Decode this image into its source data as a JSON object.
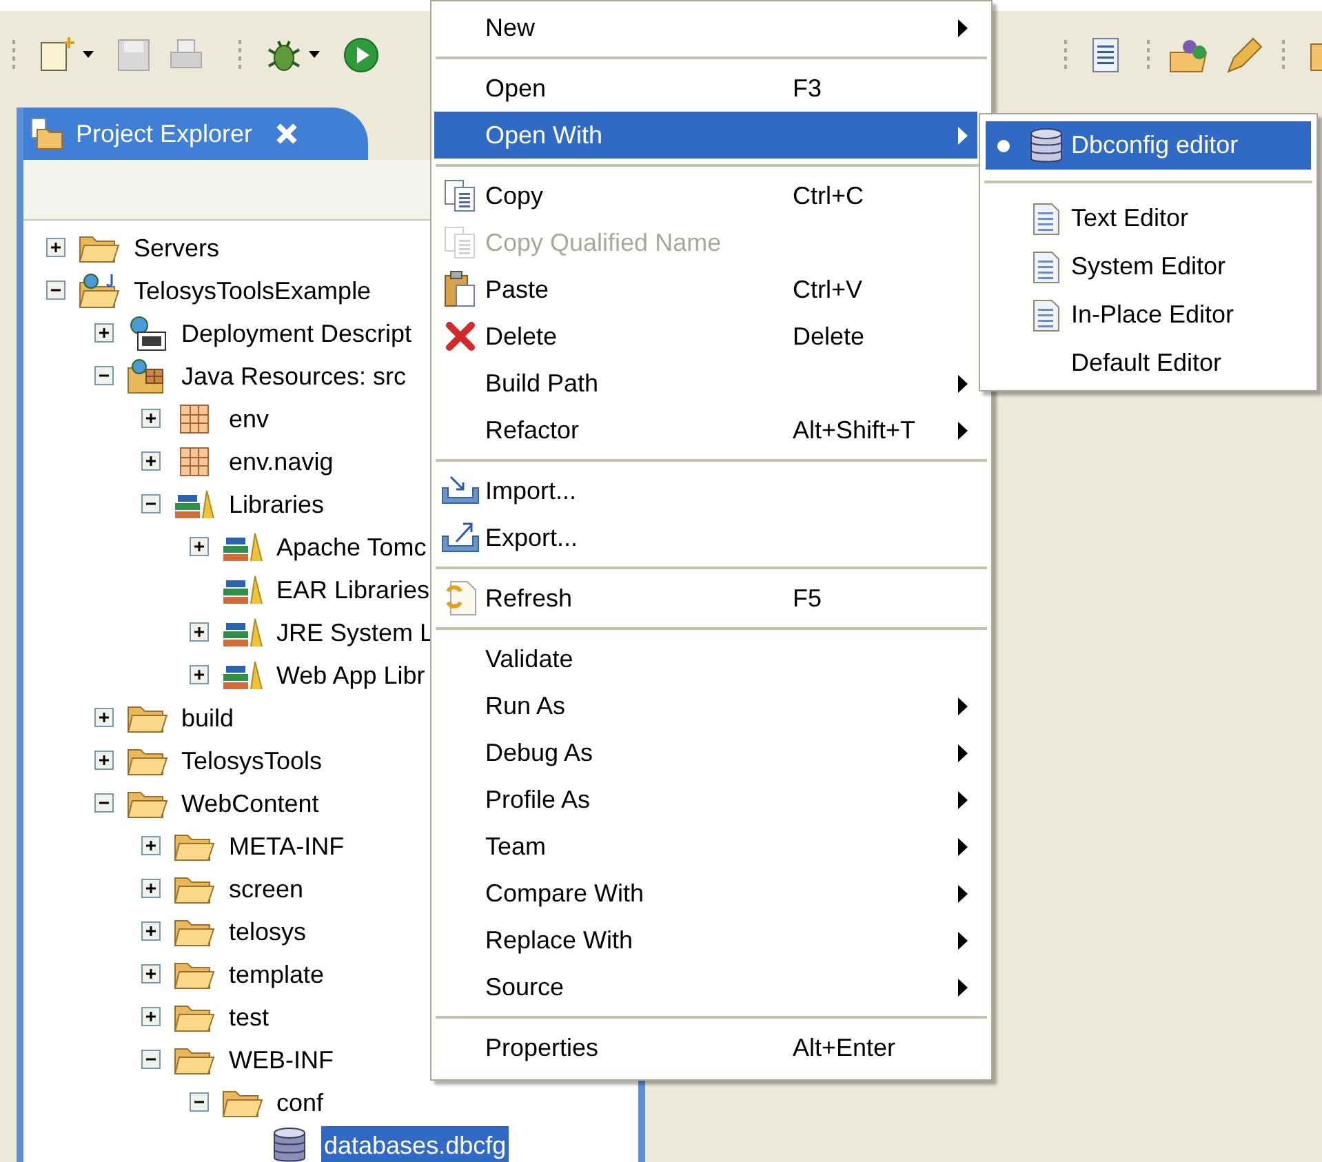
{
  "panel": {
    "title": "Project Explorer"
  },
  "tree": [
    {
      "label": "Servers",
      "kind": "folder",
      "expanded": false,
      "selected": false
    },
    {
      "label": "TelosysToolsExample",
      "kind": "project",
      "expanded": true,
      "selected": false,
      "children": [
        {
          "label": "Deployment Descript",
          "kind": "descriptor",
          "expanded": false,
          "selected": false
        },
        {
          "label": "Java Resources: src",
          "kind": "source",
          "expanded": true,
          "selected": false,
          "children": [
            {
              "label": "env",
              "kind": "package",
              "expanded": false,
              "selected": false
            },
            {
              "label": "env.navig",
              "kind": "package",
              "expanded": false,
              "selected": false
            },
            {
              "label": "Libraries",
              "kind": "library",
              "expanded": true,
              "selected": false,
              "children": [
                {
                  "label": "Apache Tomc",
                  "kind": "library",
                  "expanded": false,
                  "selected": false
                },
                {
                  "label": "EAR Libraries",
                  "kind": "library",
                  "selected": false
                },
                {
                  "label": "JRE System L",
                  "kind": "library",
                  "expanded": false,
                  "selected": false
                },
                {
                  "label": "Web App Libr",
                  "kind": "library",
                  "expanded": false,
                  "selected": false
                }
              ]
            }
          ]
        },
        {
          "label": "build",
          "kind": "folder",
          "expanded": false,
          "selected": false
        },
        {
          "label": "TelosysTools",
          "kind": "folder",
          "expanded": false,
          "selected": false
        },
        {
          "label": "WebContent",
          "kind": "folder",
          "expanded": true,
          "selected": false,
          "children": [
            {
              "label": "META-INF",
              "kind": "folder",
              "expanded": false,
              "selected": false
            },
            {
              "label": "screen",
              "kind": "folder",
              "expanded": false,
              "selected": false
            },
            {
              "label": "telosys",
              "kind": "folder",
              "expanded": false,
              "selected": false
            },
            {
              "label": "template",
              "kind": "folder",
              "expanded": false,
              "selected": false
            },
            {
              "label": "test",
              "kind": "folder",
              "expanded": false,
              "selected": false
            },
            {
              "label": "WEB-INF",
              "kind": "folder",
              "expanded": true,
              "selected": false,
              "children": [
                {
                  "label": "conf",
                  "kind": "folder",
                  "expanded": true,
                  "selected": false,
                  "children": [
                    {
                      "label": "databases.dbcfg",
                      "kind": "database",
                      "selected": true
                    }
                  ]
                }
              ]
            }
          ]
        }
      ]
    }
  ],
  "context_menu": [
    {
      "kind": "item",
      "label": "New",
      "submenu": true,
      "selected": false,
      "disabled": false
    },
    {
      "kind": "separator"
    },
    {
      "kind": "item",
      "label": "Open",
      "shortcut": "F3",
      "submenu": false,
      "selected": false,
      "disabled": false
    },
    {
      "kind": "item",
      "label": "Open With",
      "submenu": true,
      "selected": true,
      "disabled": false
    },
    {
      "kind": "separator"
    },
    {
      "kind": "copy",
      "label": "Copy",
      "shortcut": "Ctrl+C",
      "submenu": false,
      "selected": false,
      "disabled": false
    },
    {
      "kind": "copy",
      "label": "Copy Qualified Name",
      "submenu": false,
      "selected": false,
      "disabled": true
    },
    {
      "kind": "paste",
      "label": "Paste",
      "shortcut": "Ctrl+V",
      "submenu": false,
      "selected": false,
      "disabled": false
    },
    {
      "kind": "delete",
      "label": "Delete",
      "shortcut": "Delete",
      "submenu": false,
      "selected": false,
      "disabled": false
    },
    {
      "kind": "item",
      "label": "Build Path",
      "submenu": true,
      "selected": false,
      "disabled": false
    },
    {
      "kind": "item",
      "label": "Refactor",
      "shortcut": "Alt+Shift+T",
      "submenu": true,
      "selected": false,
      "disabled": false
    },
    {
      "kind": "separator"
    },
    {
      "kind": "import",
      "label": "Import...",
      "submenu": false,
      "selected": false,
      "disabled": false
    },
    {
      "kind": "export",
      "label": "Export...",
      "submenu": false,
      "selected": false,
      "disabled": false
    },
    {
      "kind": "separator"
    },
    {
      "kind": "refresh",
      "label": "Refresh",
      "shortcut": "F5",
      "submenu": false,
      "selected": false,
      "disabled": false
    },
    {
      "kind": "separator"
    },
    {
      "kind": "item",
      "label": "Validate",
      "submenu": false,
      "selected": false,
      "disabled": false
    },
    {
      "kind": "item",
      "label": "Run As",
      "submenu": true,
      "selected": false,
      "disabled": false
    },
    {
      "kind": "item",
      "label": "Debug As",
      "submenu": true,
      "selected": false,
      "disabled": false
    },
    {
      "kind": "item",
      "label": "Profile As",
      "submenu": true,
      "selected": false,
      "disabled": false
    },
    {
      "kind": "item",
      "label": "Team",
      "submenu": true,
      "selected": false,
      "disabled": false
    },
    {
      "kind": "item",
      "label": "Compare With",
      "submenu": true,
      "selected": false,
      "disabled": false
    },
    {
      "kind": "item",
      "label": "Replace With",
      "submenu": true,
      "selected": false,
      "disabled": false
    },
    {
      "kind": "item",
      "label": "Source",
      "submenu": true,
      "selected": false,
      "disabled": false
    },
    {
      "kind": "separator"
    },
    {
      "kind": "item",
      "label": "Properties",
      "shortcut": "Alt+Enter",
      "submenu": false,
      "selected": false,
      "disabled": false
    }
  ],
  "open_with_menu": [
    {
      "kind": "database",
      "label": "Dbconfig editor",
      "checked": true,
      "selected": true
    },
    {
      "kind": "separator"
    },
    {
      "kind": "document",
      "label": "Text Editor",
      "checked": false,
      "selected": false
    },
    {
      "kind": "document",
      "label": "System Editor",
      "checked": false,
      "selected": false
    },
    {
      "kind": "document",
      "label": "In-Place Editor",
      "checked": false,
      "selected": false
    },
    {
      "kind": "item",
      "label": "Default Editor",
      "checked": false,
      "selected": false
    }
  ]
}
